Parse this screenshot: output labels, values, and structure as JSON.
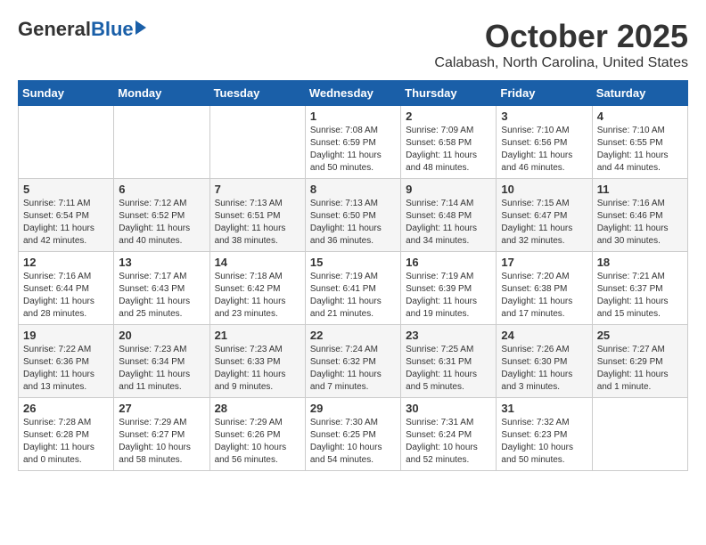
{
  "logo": {
    "general": "General",
    "blue": "Blue"
  },
  "header": {
    "month": "October 2025",
    "location": "Calabash, North Carolina, United States"
  },
  "weekdays": [
    "Sunday",
    "Monday",
    "Tuesday",
    "Wednesday",
    "Thursday",
    "Friday",
    "Saturday"
  ],
  "weeks": [
    [
      {
        "day": "",
        "info": ""
      },
      {
        "day": "",
        "info": ""
      },
      {
        "day": "",
        "info": ""
      },
      {
        "day": "1",
        "info": "Sunrise: 7:08 AM\nSunset: 6:59 PM\nDaylight: 11 hours\nand 50 minutes."
      },
      {
        "day": "2",
        "info": "Sunrise: 7:09 AM\nSunset: 6:58 PM\nDaylight: 11 hours\nand 48 minutes."
      },
      {
        "day": "3",
        "info": "Sunrise: 7:10 AM\nSunset: 6:56 PM\nDaylight: 11 hours\nand 46 minutes."
      },
      {
        "day": "4",
        "info": "Sunrise: 7:10 AM\nSunset: 6:55 PM\nDaylight: 11 hours\nand 44 minutes."
      }
    ],
    [
      {
        "day": "5",
        "info": "Sunrise: 7:11 AM\nSunset: 6:54 PM\nDaylight: 11 hours\nand 42 minutes."
      },
      {
        "day": "6",
        "info": "Sunrise: 7:12 AM\nSunset: 6:52 PM\nDaylight: 11 hours\nand 40 minutes."
      },
      {
        "day": "7",
        "info": "Sunrise: 7:13 AM\nSunset: 6:51 PM\nDaylight: 11 hours\nand 38 minutes."
      },
      {
        "day": "8",
        "info": "Sunrise: 7:13 AM\nSunset: 6:50 PM\nDaylight: 11 hours\nand 36 minutes."
      },
      {
        "day": "9",
        "info": "Sunrise: 7:14 AM\nSunset: 6:48 PM\nDaylight: 11 hours\nand 34 minutes."
      },
      {
        "day": "10",
        "info": "Sunrise: 7:15 AM\nSunset: 6:47 PM\nDaylight: 11 hours\nand 32 minutes."
      },
      {
        "day": "11",
        "info": "Sunrise: 7:16 AM\nSunset: 6:46 PM\nDaylight: 11 hours\nand 30 minutes."
      }
    ],
    [
      {
        "day": "12",
        "info": "Sunrise: 7:16 AM\nSunset: 6:44 PM\nDaylight: 11 hours\nand 28 minutes."
      },
      {
        "day": "13",
        "info": "Sunrise: 7:17 AM\nSunset: 6:43 PM\nDaylight: 11 hours\nand 25 minutes."
      },
      {
        "day": "14",
        "info": "Sunrise: 7:18 AM\nSunset: 6:42 PM\nDaylight: 11 hours\nand 23 minutes."
      },
      {
        "day": "15",
        "info": "Sunrise: 7:19 AM\nSunset: 6:41 PM\nDaylight: 11 hours\nand 21 minutes."
      },
      {
        "day": "16",
        "info": "Sunrise: 7:19 AM\nSunset: 6:39 PM\nDaylight: 11 hours\nand 19 minutes."
      },
      {
        "day": "17",
        "info": "Sunrise: 7:20 AM\nSunset: 6:38 PM\nDaylight: 11 hours\nand 17 minutes."
      },
      {
        "day": "18",
        "info": "Sunrise: 7:21 AM\nSunset: 6:37 PM\nDaylight: 11 hours\nand 15 minutes."
      }
    ],
    [
      {
        "day": "19",
        "info": "Sunrise: 7:22 AM\nSunset: 6:36 PM\nDaylight: 11 hours\nand 13 minutes."
      },
      {
        "day": "20",
        "info": "Sunrise: 7:23 AM\nSunset: 6:34 PM\nDaylight: 11 hours\nand 11 minutes."
      },
      {
        "day": "21",
        "info": "Sunrise: 7:23 AM\nSunset: 6:33 PM\nDaylight: 11 hours\nand 9 minutes."
      },
      {
        "day": "22",
        "info": "Sunrise: 7:24 AM\nSunset: 6:32 PM\nDaylight: 11 hours\nand 7 minutes."
      },
      {
        "day": "23",
        "info": "Sunrise: 7:25 AM\nSunset: 6:31 PM\nDaylight: 11 hours\nand 5 minutes."
      },
      {
        "day": "24",
        "info": "Sunrise: 7:26 AM\nSunset: 6:30 PM\nDaylight: 11 hours\nand 3 minutes."
      },
      {
        "day": "25",
        "info": "Sunrise: 7:27 AM\nSunset: 6:29 PM\nDaylight: 11 hours\nand 1 minute."
      }
    ],
    [
      {
        "day": "26",
        "info": "Sunrise: 7:28 AM\nSunset: 6:28 PM\nDaylight: 11 hours\nand 0 minutes."
      },
      {
        "day": "27",
        "info": "Sunrise: 7:29 AM\nSunset: 6:27 PM\nDaylight: 10 hours\nand 58 minutes."
      },
      {
        "day": "28",
        "info": "Sunrise: 7:29 AM\nSunset: 6:26 PM\nDaylight: 10 hours\nand 56 minutes."
      },
      {
        "day": "29",
        "info": "Sunrise: 7:30 AM\nSunset: 6:25 PM\nDaylight: 10 hours\nand 54 minutes."
      },
      {
        "day": "30",
        "info": "Sunrise: 7:31 AM\nSunset: 6:24 PM\nDaylight: 10 hours\nand 52 minutes."
      },
      {
        "day": "31",
        "info": "Sunrise: 7:32 AM\nSunset: 6:23 PM\nDaylight: 10 hours\nand 50 minutes."
      },
      {
        "day": "",
        "info": ""
      }
    ]
  ]
}
